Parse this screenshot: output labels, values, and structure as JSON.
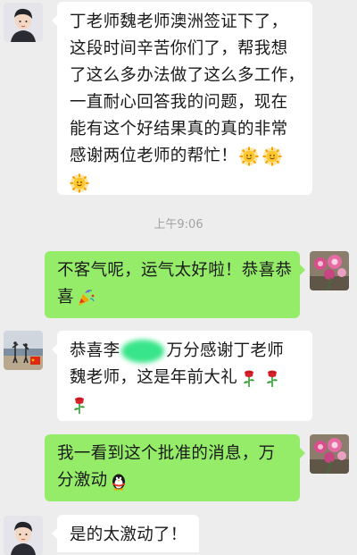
{
  "timestamp": "上午9:06",
  "messages": [
    {
      "side": "in",
      "avatar_icon": "boy-cartoon-avatar",
      "lines": [
        "丁老师魏老师澳洲签证下了，",
        "这段时间辛苦你们了，帮我想",
        "了这么多办法做了这么多工作，",
        "一直耐心回答我的问题，现在",
        "能有这个好结果真的真的非常",
        "感谢两位老师的帮忙！"
      ],
      "emojis": [
        "sun-emoji",
        "sun-emoji",
        "sun-emoji"
      ]
    },
    {
      "side": "out",
      "avatar_icon": "flower-avatar",
      "lines": [
        "不客气呢，运气太好啦！恭喜恭",
        "喜"
      ],
      "emojis": [
        "party-popper-emoji"
      ]
    },
    {
      "side": "in",
      "avatar_icon": "beach-photo-avatar",
      "line1_pre": "恭喜李",
      "line1_post": "万分感谢丁老师",
      "line2": "魏老师，这是年前大礼",
      "emojis": [
        "rose-emoji",
        "rose-emoji",
        "rose-emoji"
      ]
    },
    {
      "side": "out",
      "avatar_icon": "flower-avatar",
      "lines": [
        "我一看到这个批准的消息，万",
        "分激动"
      ],
      "emojis": [
        "penguin-emoji"
      ]
    },
    {
      "side": "in",
      "avatar_icon": "boy-cartoon-avatar",
      "lines": [
        "是的太激动了！"
      ]
    }
  ],
  "colors": {
    "background": "#ededed",
    "incoming_bubble": "#ffffff",
    "outgoing_bubble": "#95ec69",
    "timestamp_text": "#a3a3a3"
  }
}
